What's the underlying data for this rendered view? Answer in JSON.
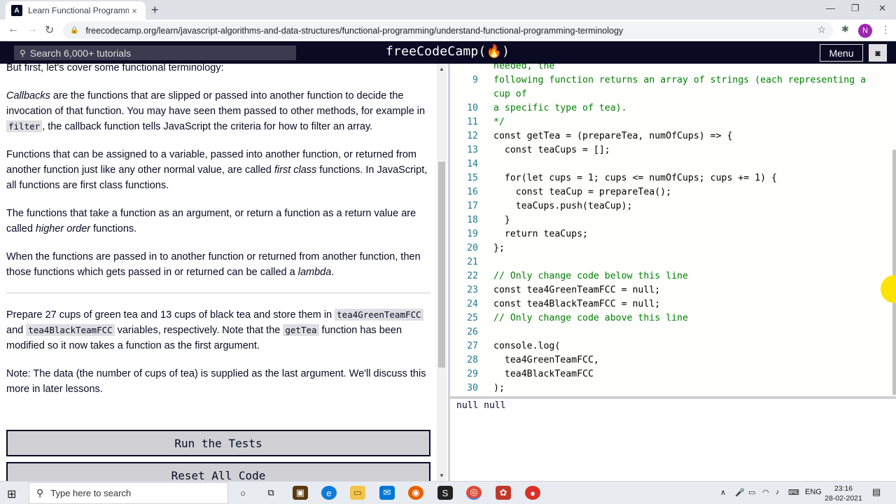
{
  "browser": {
    "tab_title": "Learn Functional Programming: U",
    "tab_close": "×",
    "new_tab": "+",
    "url": "freecodecamp.org/learn/javascript-algorithms-and-data-structures/functional-programming/understand-functional-programming-terminology",
    "profile_initial": "N",
    "window_controls": [
      "—",
      "❐",
      "✕"
    ]
  },
  "fcc": {
    "search_placeholder": "Search 6,000+ tutorials",
    "logo": "freeCodeCamp(🔥)",
    "menu_label": "Menu"
  },
  "lesson": {
    "intro": "But first, let's cover some functional terminology:",
    "callbacks_term": "Callbacks",
    "callbacks_text": " are the functions that are slipped or passed into another function to decide the invocation of that function. You may have seen them passed to other methods, for example in ",
    "filter_code": "filter",
    "callbacks_tail": ", the callback function tells JavaScript the criteria for how to filter an array.",
    "first_class_pre": "Functions that can be assigned to a variable, passed into another function, or returned from another function just like any other normal value, are called ",
    "first_class_term": "first class",
    "first_class_post": " functions. In JavaScript, all functions are first class functions.",
    "higher_order_pre": "The functions that take a function as an argument, or return a function as a return value are called ",
    "higher_order_term": "higher order",
    "higher_order_post": " functions.",
    "lambda_pre": "When the functions are passed in to another function or returned from another function, then those functions which gets passed in or returned can be called a ",
    "lambda_term": "lambda",
    "lambda_post": ".",
    "task_pre": "Prepare 27 cups of green tea and 13 cups of black tea and store them in ",
    "task_code1": "tea4GreenTeamFCC",
    "task_and": " and ",
    "task_code2": "tea4BlackTeamFCC",
    "task_mid": " variables, respectively. Note that the ",
    "task_code3": "getTea",
    "task_post": " function has been modified so it now takes a function as the first argument.",
    "note": "Note: The data (the number of cups of tea) is supplied as the last argument. We'll discuss this more in later lessons.",
    "run_button": "Run the Tests",
    "reset_button": "Reset All Code"
  },
  "editor": {
    "lines": [
      {
        "n": "",
        "t": "needed, the",
        "c": "cm"
      },
      {
        "n": "9",
        "t": "following function returns an array of strings (each representing a",
        "c": "cm"
      },
      {
        "n": "",
        "t": "cup of",
        "c": "cm"
      },
      {
        "n": "10",
        "t": "a specific type of tea).",
        "c": "cm"
      },
      {
        "n": "11",
        "t": "*/",
        "c": "cm"
      },
      {
        "n": "12",
        "t": "const getTea = (prepareTea, numOfCups) => {",
        "c": ""
      },
      {
        "n": "13",
        "t": "  const teaCups = [];",
        "c": ""
      },
      {
        "n": "14",
        "t": "",
        "c": ""
      },
      {
        "n": "15",
        "t": "  for(let cups = 1; cups <= numOfCups; cups += 1) {",
        "c": ""
      },
      {
        "n": "16",
        "t": "    const teaCup = prepareTea();",
        "c": ""
      },
      {
        "n": "17",
        "t": "    teaCups.push(teaCup);",
        "c": ""
      },
      {
        "n": "18",
        "t": "  }",
        "c": ""
      },
      {
        "n": "19",
        "t": "  return teaCups;",
        "c": ""
      },
      {
        "n": "20",
        "t": "};",
        "c": ""
      },
      {
        "n": "21",
        "t": "",
        "c": ""
      },
      {
        "n": "22",
        "t": "// Only change code below this line",
        "c": "cm"
      },
      {
        "n": "23",
        "t": "const tea4GreenTeamFCC = null;",
        "c": ""
      },
      {
        "n": "24",
        "t": "const tea4BlackTeamFCC = null;",
        "c": ""
      },
      {
        "n": "25",
        "t": "// Only change code above this line",
        "c": "cm"
      },
      {
        "n": "26",
        "t": "",
        "c": ""
      },
      {
        "n": "27",
        "t": "console.log(",
        "c": ""
      },
      {
        "n": "28",
        "t": "  tea4GreenTeamFCC,",
        "c": ""
      },
      {
        "n": "29",
        "t": "  tea4BlackTeamFCC",
        "c": ""
      },
      {
        "n": "30",
        "t": ");",
        "c": ""
      }
    ],
    "output": "null null"
  },
  "taskbar": {
    "search_placeholder": "Type here to search",
    "language": "ENG",
    "time": "23:16",
    "date": "28-02-2021"
  }
}
